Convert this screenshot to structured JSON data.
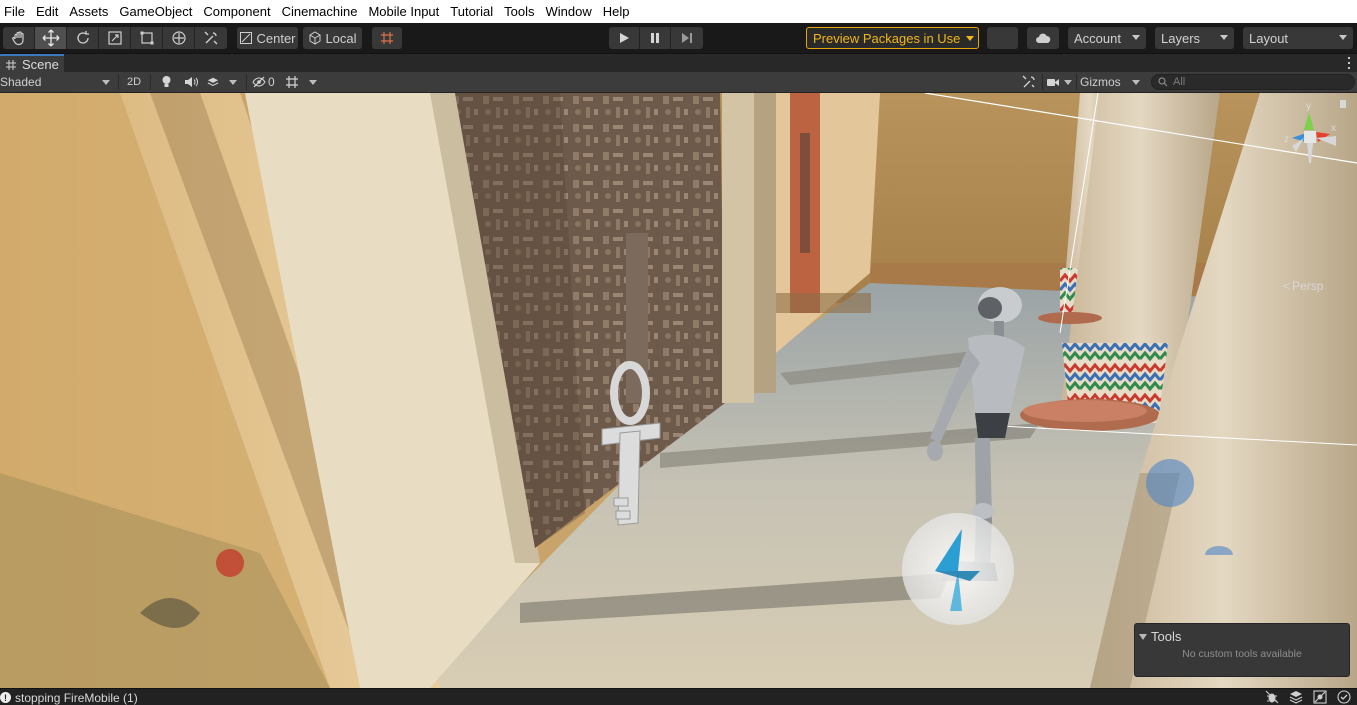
{
  "menu": {
    "items": [
      "File",
      "Edit",
      "Assets",
      "GameObject",
      "Component",
      "Cinemachine",
      "Mobile Input",
      "Tutorial",
      "Tools",
      "Window",
      "Help"
    ]
  },
  "toolbar": {
    "tools": [
      {
        "name": "hand-tool",
        "icon": "hand-icon"
      },
      {
        "name": "move-tool",
        "icon": "move-arrows-icon",
        "active": true
      },
      {
        "name": "rotate-tool",
        "icon": "rotate-icon"
      },
      {
        "name": "scale-tool",
        "icon": "scale-icon"
      },
      {
        "name": "rect-tool",
        "icon": "rect-icon"
      },
      {
        "name": "transform-tool",
        "icon": "transform-icon"
      },
      {
        "name": "custom-tool",
        "icon": "wrench-icon"
      }
    ],
    "pivot_label": "Center",
    "space_label": "Local",
    "snap_icon": "grid-snap-icon",
    "play_icon": "play-icon",
    "pause_icon": "pause-icon",
    "step_icon": "step-icon",
    "preview_packages_label": "Preview Packages in Use",
    "collab_icon": "collab-icon",
    "cloud_icon": "cloud-icon",
    "account_label": "Account",
    "layers_label": "Layers",
    "layout_label": "Layout",
    "preview_color": "#f2b71a"
  },
  "scene_tab": {
    "label": "Scene",
    "icon": "hash-icon"
  },
  "scene_toolbar": {
    "draw_mode": "Shaded",
    "mode_2d_label": "2D",
    "lighting_icon": "lightbulb-icon",
    "audio_icon": "speaker-icon",
    "effects_icon": "layers-icon",
    "hidden_count": "0",
    "grid_icon": "grid-icon",
    "tools_icon": "wrench-icon",
    "camera_icon": "camera-icon",
    "gizmos_label": "Gizmos",
    "search_placeholder": "All"
  },
  "viewport": {
    "orientation": {
      "y_label": "y",
      "z_label": "z",
      "x_label": "x"
    },
    "projection_label": "Persp",
    "tools_overlay": {
      "title": "Tools",
      "message": "No custom tools available"
    }
  },
  "status": {
    "message": "stopping FireMobile (1)",
    "icons": [
      "debug-icon",
      "layers-status-icon",
      "progress-icon",
      "check-icon"
    ]
  }
}
